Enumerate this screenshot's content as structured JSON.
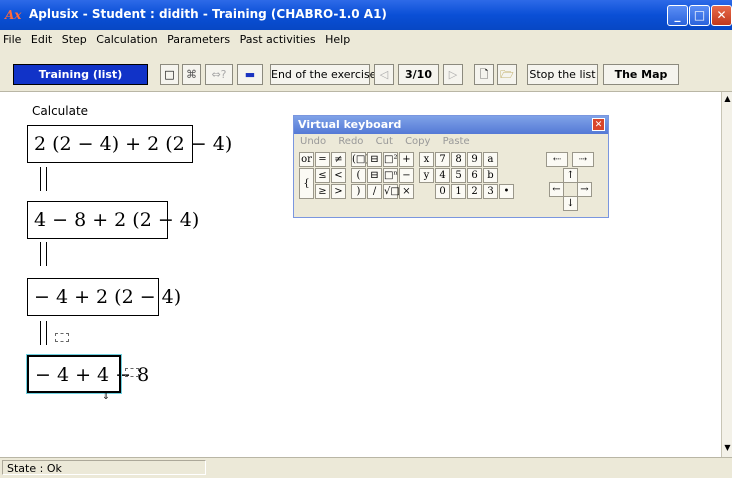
{
  "window": {
    "title": "Aplusix - Student : didith - Training (CHABRO-1.0 A1)",
    "app_icon_text": "Ax"
  },
  "menu": [
    "File",
    "Edit",
    "Step",
    "Calculation",
    "Parameters",
    "Past activities",
    "Help"
  ],
  "toolbar": {
    "mode": "Training (list)",
    "icons": [
      "□",
      "⌘",
      "⇔?",
      "▬"
    ],
    "end_exercise": "End of the exercise",
    "prev": "◁",
    "progress": "3/10",
    "next": "▷",
    "new_doc": "🗋",
    "open": "🗁",
    "stop_list": "Stop the list",
    "map": "The Map"
  },
  "work": {
    "prompt": "Calculate",
    "steps": [
      "2 (2 − 4) + 2 (2 − 4)",
      "4 − 8 + 2 (2 − 4)",
      "− 4 + 2 (2 − 4)",
      "− 4 + 4 − 8"
    ]
  },
  "keyboard": {
    "title": "Virtual keyboard",
    "menu": [
      "Undo",
      "Redo",
      "Cut",
      "Copy",
      "Paste"
    ],
    "keys": [
      "or",
      "=",
      "≠",
      "(□)",
      "⊟",
      "□²",
      "+",
      "x",
      "7",
      "8",
      "9",
      "a",
      "⇠",
      "⇢",
      "{",
      "≤",
      "<",
      "(",
      "⊟",
      "□ⁿ",
      "−",
      "y",
      "4",
      "5",
      "6",
      "b",
      "↑",
      "←",
      "→",
      "≥",
      ">",
      ")",
      "/",
      "√□",
      "×",
      "0",
      "1",
      "2",
      "3",
      "•",
      "↓"
    ]
  },
  "status": "State : Ok"
}
